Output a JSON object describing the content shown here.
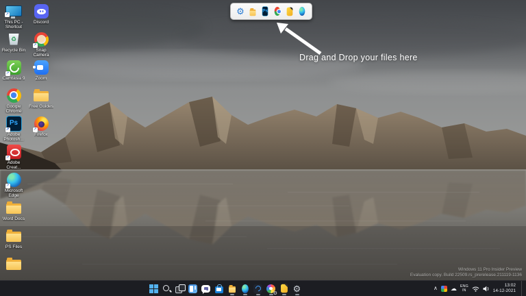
{
  "glyphs": {
    "gear": "⚙",
    "cloud": "☁",
    "chevron_up": "∧",
    "recycle": "♻",
    "photoshop_badge": "Ps"
  },
  "hint": {
    "text": "Drag and Drop your files here"
  },
  "dock": {
    "items": [
      {
        "icon": "settings-gear"
      },
      {
        "icon": "file-explorer-folder"
      },
      {
        "icon": "photoshop"
      },
      {
        "icon": "chrome"
      },
      {
        "icon": "drag-drop-app"
      },
      {
        "icon": "edge"
      }
    ]
  },
  "desktop": {
    "column1": [
      {
        "icon": "this-pc-monitor",
        "label": "This PC - Shortcut"
      },
      {
        "icon": "recycle-bin",
        "label": "Recycle Bin"
      },
      {
        "icon": "camtasia",
        "label": "Camtasia 9"
      },
      {
        "icon": "chrome",
        "label": "Google Chrome"
      },
      {
        "icon": "photoshop",
        "label": "Adobe Photosh..."
      },
      {
        "icon": "creative-cloud",
        "label": "Adobe Creat..."
      },
      {
        "icon": "edge",
        "label": "Microsoft Edge"
      },
      {
        "icon": "folder",
        "label": "Word Docs"
      },
      {
        "icon": "folder",
        "label": "PS Files"
      },
      {
        "icon": "folder",
        "label": ""
      }
    ],
    "column2": [
      {
        "icon": "discord",
        "label": "Discord"
      },
      {
        "icon": "snap-camera",
        "label": "Snap Camera"
      },
      {
        "icon": "zoom",
        "label": "Zoom"
      },
      {
        "icon": "folder",
        "label": "Free Guides"
      },
      {
        "icon": "firefox",
        "label": "Firefox"
      }
    ]
  },
  "taskbar": {
    "buttons": [
      {
        "icon": "start"
      },
      {
        "icon": "search"
      },
      {
        "icon": "task-view"
      },
      {
        "icon": "widgets"
      },
      {
        "icon": "chat"
      },
      {
        "icon": "store"
      },
      {
        "icon": "file-explorer"
      },
      {
        "icon": "edge"
      },
      {
        "icon": "dark-app"
      },
      {
        "icon": "photos-pinwheel"
      },
      {
        "icon": "drag-drop-app"
      },
      {
        "icon": "settings"
      }
    ],
    "tray": {
      "language_top": "ENG",
      "language_bottom": "IN",
      "time": "13:02",
      "date": "14-12-2021"
    }
  },
  "watermark": {
    "line1": "Windows 11 Pro Insider Preview",
    "line2": "Evaluation copy. Build 22509.rs_prerelease.211119-1136"
  },
  "colors": {
    "taskbar_bg": "#1c1d22",
    "dock_bg": "#f3f3f3",
    "accent_blue": "#4cc2ff"
  }
}
